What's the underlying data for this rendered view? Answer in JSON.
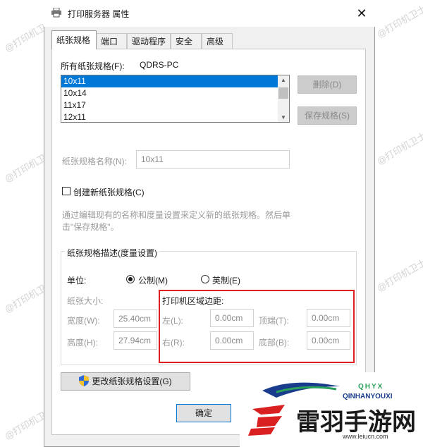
{
  "window": {
    "title": "打印服务器 属性",
    "close_glyph": "✕"
  },
  "tabs": [
    "纸张规格",
    "端口",
    "驱动程序",
    "安全",
    "高级"
  ],
  "forms_label": "所有纸张规格(F):",
  "server_name": "QDRS-PC",
  "forms_list": [
    "10x11",
    "10x14",
    "11x17",
    "12x11"
  ],
  "delete_button": "删除(D)",
  "save_form_button": "保存规格(S)",
  "form_name_label": "纸张规格名称(N):",
  "form_name_value": "10x11",
  "create_new_label": "创建新纸张规格(C)",
  "description": [
    "通过编辑现有的名称和度量设置来定义新的纸张规格。然后单",
    "击\"保存规格\"。"
  ],
  "measurements": {
    "group_title": "纸张规格描述(度量设置)",
    "units_label": "单位:",
    "metric_label": "公制(M)",
    "english_label": "英制(E)",
    "paper_size_label": "纸张大小:",
    "width_label": "宽度(W):",
    "width_value": "25.40cm",
    "height_label": "高度(H):",
    "height_value": "27.94cm",
    "margins_title": "打印机区域边距:",
    "left_label": "左(L):",
    "left_value": "0.00cm",
    "right_label": "右(R):",
    "right_value": "0.00cm",
    "top_label": "顶端(T):",
    "top_value": "0.00cm",
    "bottom_label": "底部(B):",
    "bottom_value": "0.00cm"
  },
  "change_settings_button": "更改纸张规格设置(G)",
  "ok_button": "确定",
  "watermark": "@打印机卫士",
  "logo": {
    "brand": "QINHANYOUXI",
    "name": "雷羽手游网",
    "url": "www.leiucn.com",
    "badge": "QHYX"
  },
  "colors": {
    "selection": "#0078d7",
    "highlight_box": "#e02020",
    "logo_red": "#d92020",
    "logo_blue": "#1a3c8c"
  }
}
